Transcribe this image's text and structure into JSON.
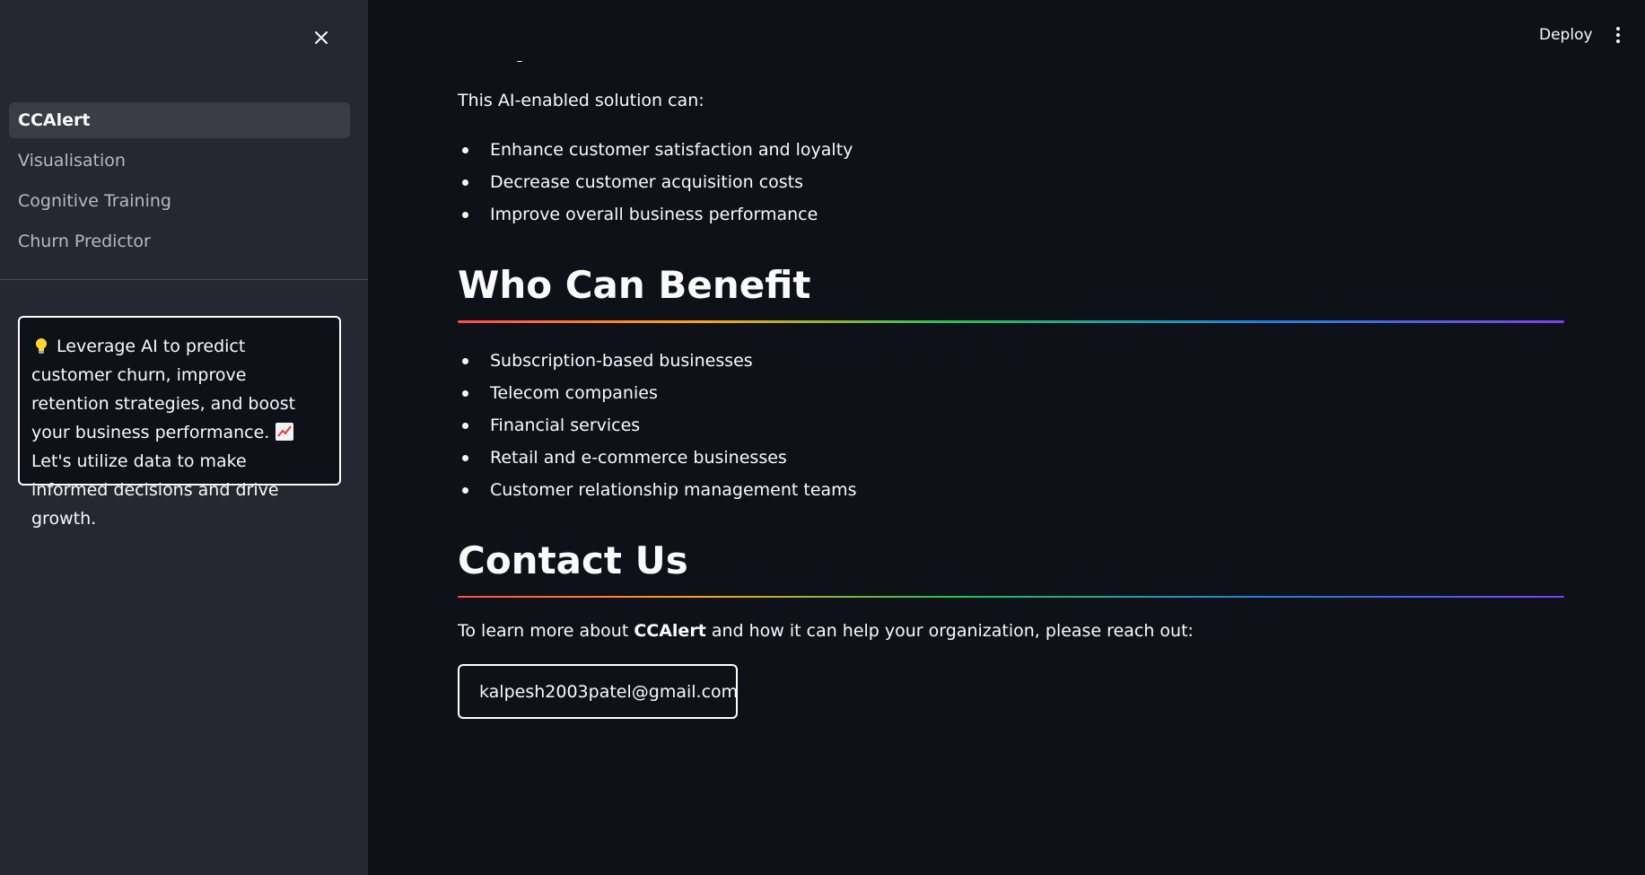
{
  "sidebar": {
    "nav": [
      {
        "label": "CCAlert",
        "active": true
      },
      {
        "label": "Visualisation",
        "active": false
      },
      {
        "label": "Cognitive Training",
        "active": false
      },
      {
        "label": "Churn Predictor",
        "active": false
      }
    ],
    "info_card": {
      "line1": "Leverage AI to predict customer churn, improve retention strategies, and boost your business performance.",
      "line2": "Let's utilize data to make informed decisions and drive growth."
    }
  },
  "header": {
    "deploy_label": "Deploy"
  },
  "main": {
    "partial_bullet": "Target interventions and resources to retain customers",
    "lead": "This AI-enabled solution can:",
    "benefits_list": [
      "Enhance customer satisfaction and loyalty",
      "Decrease customer acquisition costs",
      "Improve overall business performance"
    ],
    "who_heading": "Who Can Benefit",
    "who_list": [
      "Subscription-based businesses",
      "Telecom companies",
      "Financial services",
      "Retail and e-commerce businesses",
      "Customer relationship management teams"
    ],
    "contact_heading": "Contact Us",
    "contact_text_before": "To learn more about ",
    "contact_text_bold": "CCAlert",
    "contact_text_after": " and how it can help your organization, please reach out:",
    "email": "kalpesh2003patel@gmail.com"
  },
  "icons": {
    "close": "close-icon",
    "menu": "kebab-menu-icon",
    "bulb": "lightbulb-icon",
    "chart": "chart-increasing-icon",
    "email": "envelope-icon"
  },
  "colors": {
    "background": "#0e1117",
    "sidebar": "#262730",
    "nav_active": "#3b3c46",
    "gradient": [
      "#ff4b4b",
      "#ffa421",
      "#21c354",
      "#1c83e1",
      "#803df5"
    ]
  }
}
